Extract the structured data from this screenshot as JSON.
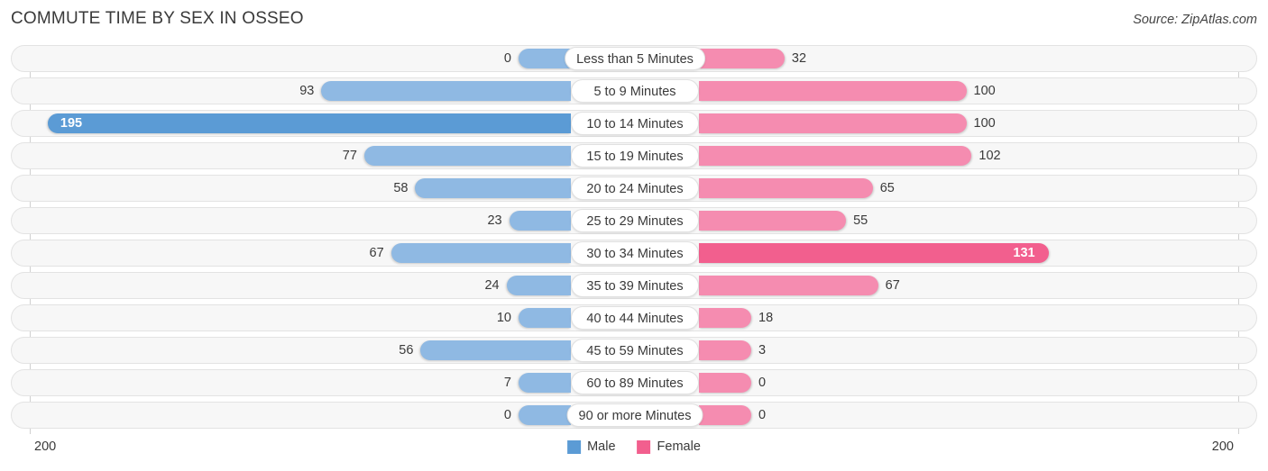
{
  "header": {
    "title": "COMMUTE TIME BY SEX IN OSSEO",
    "source": "Source: ZipAtlas.com"
  },
  "axis": {
    "left_tick": "200",
    "right_tick": "200"
  },
  "legend": {
    "items": [
      {
        "label": "Male",
        "color": "#5b9bd5"
      },
      {
        "label": "Female",
        "color": "#f25f8e"
      }
    ]
  },
  "colors": {
    "male_normal": "#8fb9e3",
    "male_max": "#5b9bd5",
    "female_normal": "#f58cb0",
    "female_max": "#f25f8e",
    "track": "#f7f7f7",
    "track_border": "#e3e3e3"
  },
  "chart_data": {
    "type": "bar",
    "subtype": "diverging-bidirectional",
    "title": "COMMUTE TIME BY SEX IN OSSEO",
    "xlabel": "",
    "ylabel": "",
    "xlim": [
      200,
      200
    ],
    "axis_max": 200,
    "grid": false,
    "legend_position": "bottom-center",
    "categories": [
      "Less than 5 Minutes",
      "5 to 9 Minutes",
      "10 to 14 Minutes",
      "15 to 19 Minutes",
      "20 to 24 Minutes",
      "25 to 29 Minutes",
      "30 to 34 Minutes",
      "35 to 39 Minutes",
      "40 to 44 Minutes",
      "45 to 59 Minutes",
      "60 to 89 Minutes",
      "90 or more Minutes"
    ],
    "series": [
      {
        "name": "Male",
        "direction": "left",
        "color": "#8fb9e3",
        "max_color": "#5b9bd5",
        "values": [
          0,
          93,
          195,
          77,
          58,
          23,
          67,
          24,
          10,
          56,
          7,
          0
        ]
      },
      {
        "name": "Female",
        "direction": "right",
        "color": "#f58cb0",
        "max_color": "#f25f8e",
        "values": [
          32,
          100,
          100,
          102,
          65,
          55,
          131,
          67,
          18,
          3,
          0,
          0
        ]
      }
    ]
  }
}
